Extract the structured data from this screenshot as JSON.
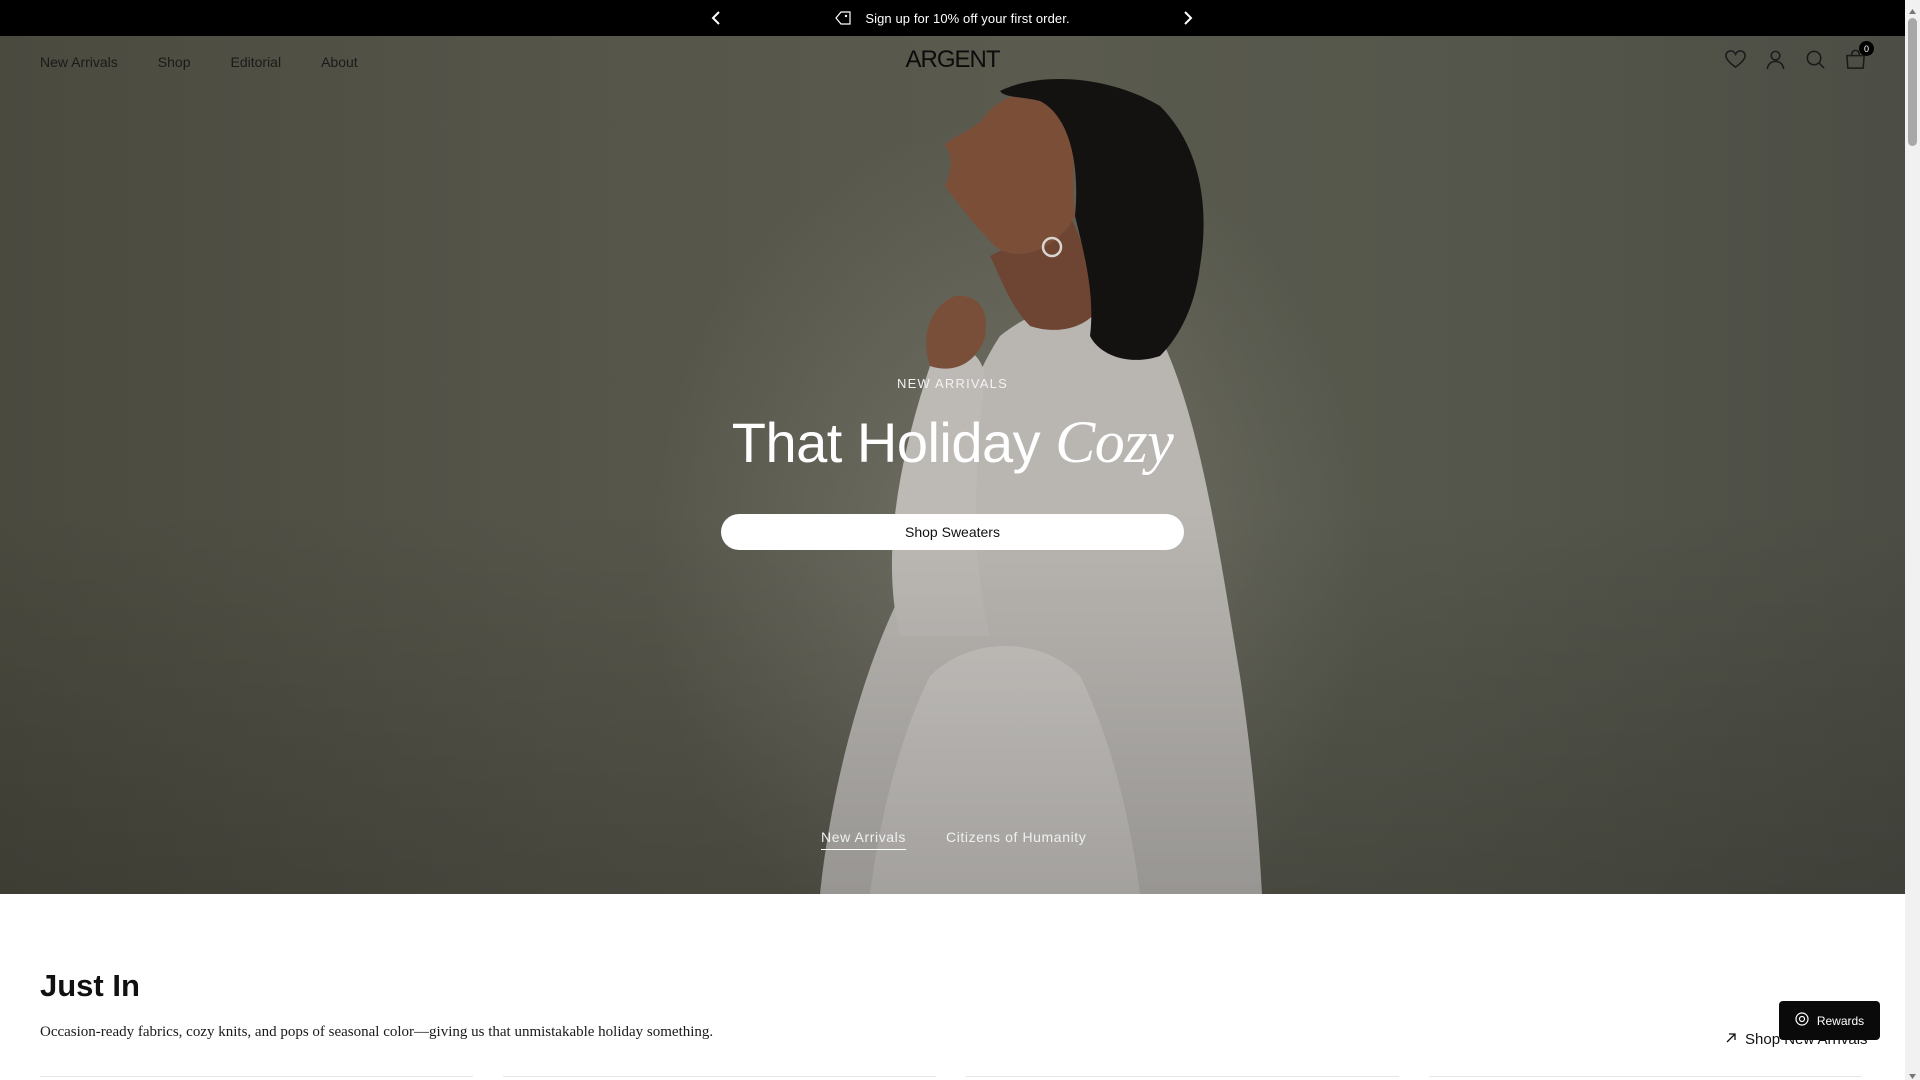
{
  "announcement": {
    "text": "Sign up for 10% off your first order.",
    "tag_icon": "tag-icon",
    "prev_icon": "chevron-left-icon",
    "next_icon": "chevron-right-icon"
  },
  "header": {
    "nav": [
      "New Arrivals",
      "Shop",
      "Editorial",
      "About"
    ],
    "logo": "ARGENT",
    "icons": [
      "heart-icon",
      "account-icon",
      "search-icon",
      "cart-icon"
    ],
    "cart_count": "0"
  },
  "hero": {
    "eyebrow": "NEW ARRIVALS",
    "headline": "That Holiday",
    "headline_italic": "Cozy",
    "cta": "Shop Sweaters",
    "tabs": [
      "New Arrivals",
      "Citizens of Humanity"
    ],
    "active_tab": "New Arrivals"
  },
  "just_in": {
    "title": "Just In",
    "description": "Occasion-ready fabrics, cozy knits, and pops of seasonal color—giving us that unmistakable holiday something.",
    "link": "Shop New Arrivals"
  },
  "rewards": {
    "label": "Rewards"
  },
  "colors": {
    "announcement_bg": "#000000",
    "hero_bg": "#56564a",
    "rewards_bg": "#0a0a0a"
  }
}
